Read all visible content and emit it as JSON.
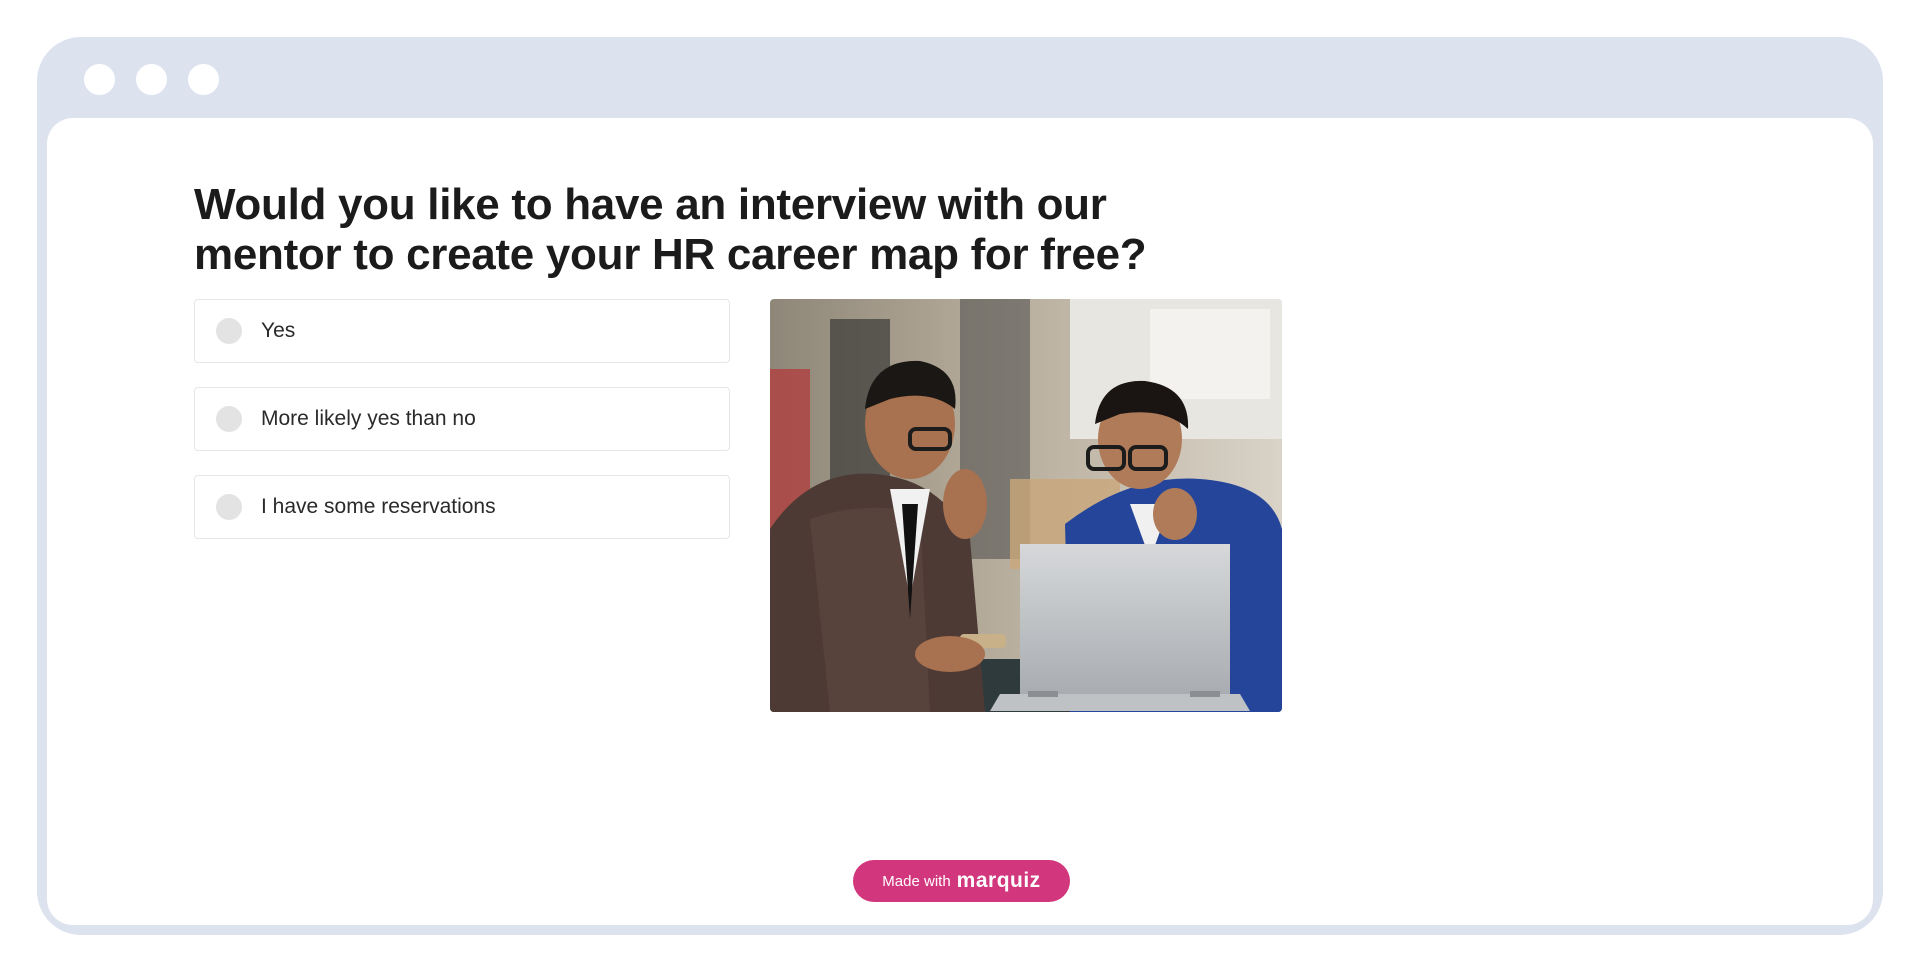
{
  "quiz": {
    "question": "Would you like to have an interview with our mentor to create your HR career map for free?",
    "answers": [
      {
        "label": "Yes"
      },
      {
        "label": "More likely yes than no"
      },
      {
        "label": "I have some reservations"
      }
    ]
  },
  "footer": {
    "made_with": "Made with",
    "brand": "marquiz"
  },
  "colors": {
    "frame": "#dde3ee",
    "badge": "#d2367d",
    "radio": "#e3e3e3"
  },
  "icons": {
    "window_controls": [
      "window-dot-icon",
      "window-dot-icon",
      "window-dot-icon"
    ]
  }
}
